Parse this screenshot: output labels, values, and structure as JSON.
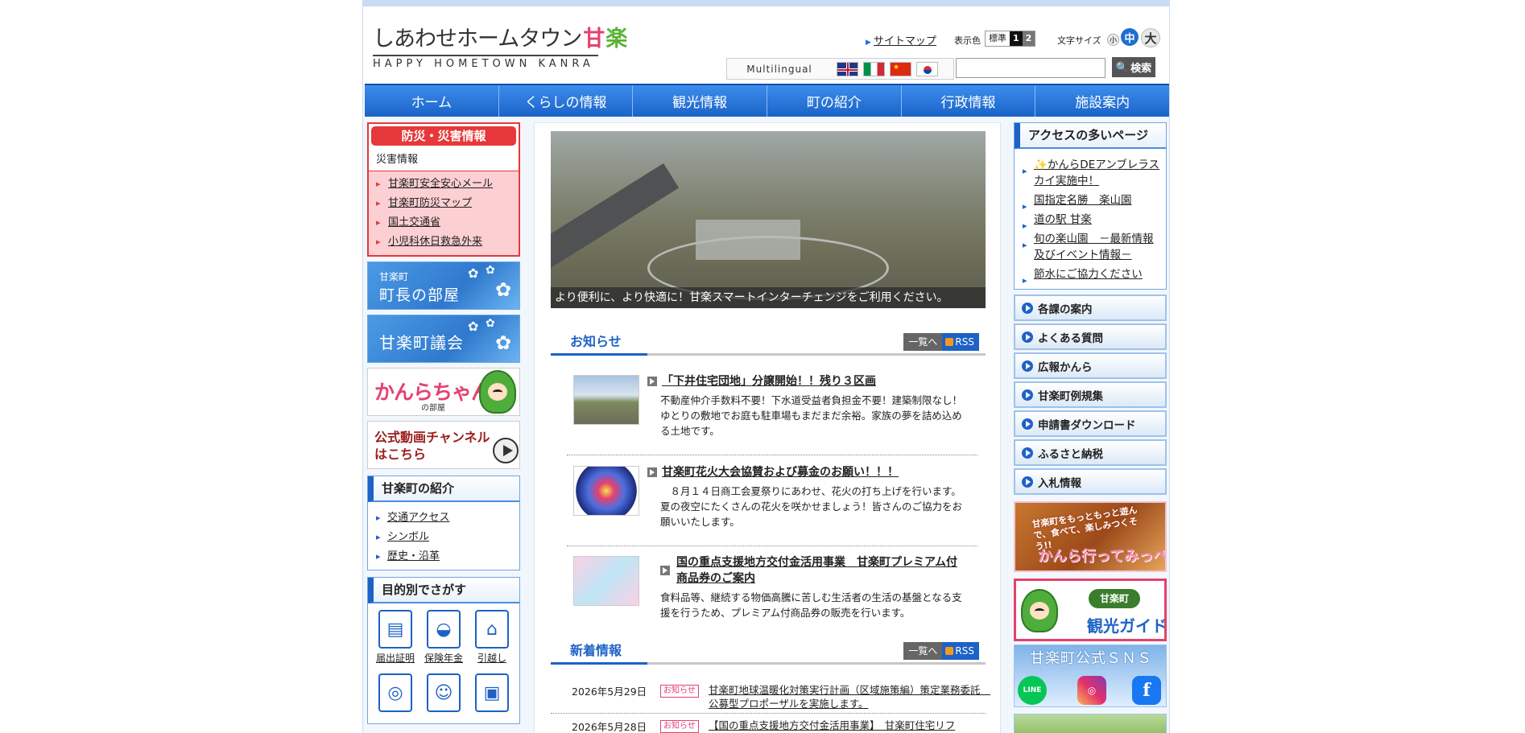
{
  "header": {
    "logo_jp_main": "しあわせホームタウン",
    "logo_jp_accent1": "甘",
    "logo_jp_accent2": "楽",
    "logo_en": "HAPPY HOMETOWN KANRA",
    "sitemap_label": "サイトマップ",
    "display_color_label": "表示色",
    "display_color_standard": "標準",
    "display_color_1": "1",
    "display_color_2": "2",
    "font_size_label": "文字サイズ",
    "font_small": "小",
    "font_medium": "中",
    "font_large": "大",
    "multilingual_label": "Multilingual",
    "search_placeholder": "",
    "search_button": "検索"
  },
  "global_nav": [
    {
      "label": "ホーム"
    },
    {
      "label": "くらしの情報"
    },
    {
      "label": "観光情報"
    },
    {
      "label": "町の紹介"
    },
    {
      "label": "行政情報"
    },
    {
      "label": "施設案内"
    }
  ],
  "left": {
    "disaster_title": "防災・災害情報",
    "disaster_sub": "災害情報",
    "disaster_links": [
      "甘楽町安全安心メール",
      "甘楽町防災マップ",
      "国土交通省",
      "小児科休日救急外来"
    ],
    "mayor_small": "甘楽町",
    "mayor_big": "町長の部屋",
    "council": "甘楽町議会",
    "kanra_chan": "かんらちゃん",
    "kanra_chan_sub": "の部屋",
    "video_banner": "公式動画チャンネルはこちら",
    "intro_title": "甘楽町の紹介",
    "intro_links": [
      "交通アクセス",
      "シンボル",
      "歴史・沿革"
    ],
    "purpose_title": "目的別でさがす",
    "purposes": [
      {
        "label": "届出証明",
        "icon": "document-icon"
      },
      {
        "label": "保険年金",
        "icon": "purse-icon"
      },
      {
        "label": "引越し",
        "icon": "house-icon"
      },
      {
        "label": "",
        "icon": "ring-icon"
      },
      {
        "label": "",
        "icon": "person-icon"
      },
      {
        "label": "",
        "icon": "bag-icon"
      }
    ]
  },
  "main": {
    "hero_caption": "より便利に、より快適に！甘楽スマートインターチェンジをご利用ください。",
    "news_title": "お知らせ",
    "list_button": "一覧へ",
    "rss_button": "RSS",
    "news": [
      {
        "title": "「下井住宅団地」分譲開始！！残り３区画",
        "body": "不動産仲介手数料不要！下水道受益者負担金不要！建築制限なし！ゆとりの敷地でお庭も駐車場もまだまだ余裕。家族の夢を詰め込める土地です。"
      },
      {
        "title": "甘楽町花火大会協賛および募金のお願い！！！",
        "body": "　８月１４日商工会夏祭りにあわせ、花火の打ち上げを行います。夏の夜空にたくさんの花火を咲かせましょう！皆さんのご協力をお願いいたします。"
      },
      {
        "title": "国の重点支援地方交付金活用事業　甘楽町プレミアム付商品券のご案内",
        "body": "食料品等、継続する物価高騰に苦しむ生活者の生活の基盤となる支援を行うため、プレミアム付商品券の販売を行います。"
      }
    ],
    "new_info_title": "新着情報",
    "new_info": [
      {
        "date": "2026年5月29日",
        "tag": "お知らせ",
        "text": "甘楽町地球温暖化対策実行計画（区域施策編）策定業務委託　公募型プロポーザルを実施します。"
      },
      {
        "date": "2026年5月28日",
        "tag": "お知らせ",
        "text": "【国の重点支援地方交付金活用事業】　甘楽町住宅リフ"
      }
    ]
  },
  "right": {
    "access_title": "アクセスの多いページ",
    "access_links": [
      "かんらDEアンブレラスカイ実施中！",
      "国指定名勝　楽山園",
      "道の駅 甘楽",
      "旬の楽山園　－最新情報及びイベント情報－",
      "節水にご協力ください"
    ],
    "access_sparkle": "✨",
    "buttons": [
      "各課の案内",
      "よくある質問",
      "広報かんら",
      "甘楽町例規集",
      "申請書ダウンロード",
      "ふるさと納税",
      "入札情報"
    ],
    "banner_food_1": "甘楽町をもっともっと遊んで、食べて、楽しみつくそう!!",
    "banner_food_2": "かんら行ってみっぺぇ",
    "banner_guide_1": "甘楽町",
    "banner_guide_2": "観光ガイド",
    "banner_sns": "甘楽町公式ＳＮＳ",
    "sns": [
      {
        "name": "LINE",
        "icon": "line-icon"
      },
      {
        "name": "Instagram",
        "icon": "instagram-icon"
      },
      {
        "name": "Facebook",
        "icon": "facebook-icon"
      }
    ]
  },
  "colors": {
    "accent_blue": "#1d62c6",
    "disaster_red": "#e6383a",
    "kanra_pink": "#e6406f"
  }
}
